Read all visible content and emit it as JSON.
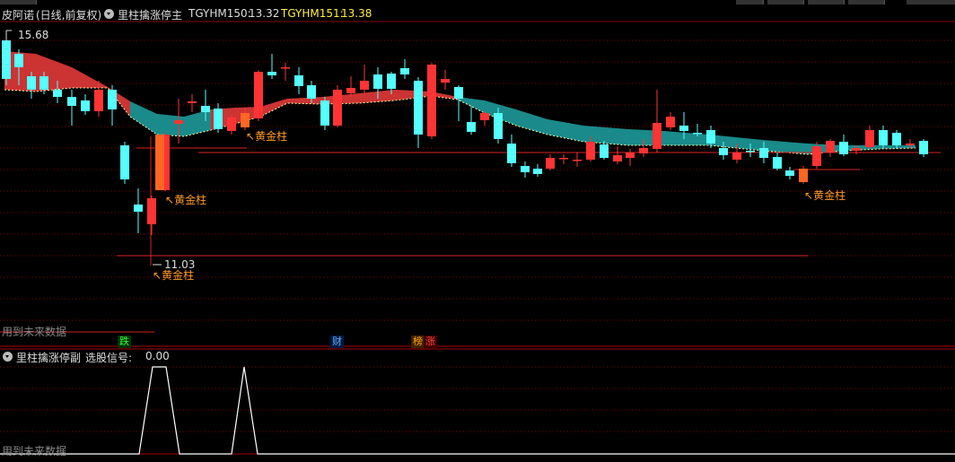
{
  "header": {
    "stock_name": "皮阿诺",
    "period": "(日线,前复权)",
    "indicator_name": "里柱擒涨停主",
    "ma1_label": "TGYHM150:",
    "ma1_value": "13.32",
    "ma2_label": "TGYHM151:",
    "ma2_value": "13.38"
  },
  "price": {
    "high_label": "15.68",
    "low_label": "11.03"
  },
  "annotations": {
    "gold1": "黄金柱",
    "gold2": "黄金柱",
    "gold3": "黄金柱",
    "gold4": "黄金柱",
    "arrow": "↖"
  },
  "future_data_label": "用到未来数据",
  "badges": {
    "fall": "跌",
    "finance": "财",
    "rank": "榜",
    "rise": "涨"
  },
  "sub": {
    "indicator_name": "里柱擒涨停副",
    "signal_label": "选股信号:",
    "signal_value": "0.00",
    "future_data_label": "用到未来数据"
  },
  "colors": {
    "up": "#ff3333",
    "down": "#54ffff",
    "gold": "#ff9922",
    "cloud_red": "#cc3333",
    "cloud_teal": "#1a8a8a",
    "grid": "#7a0000"
  }
}
